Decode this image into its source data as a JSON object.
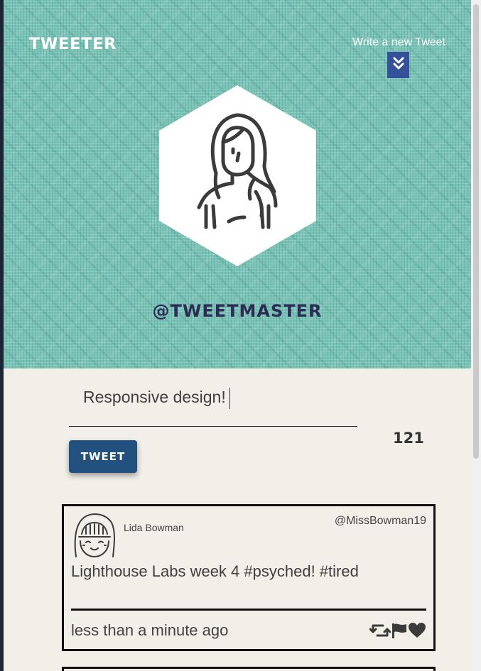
{
  "header": {
    "brand": "TWEETER",
    "write_link": "Write a new Tweet",
    "toggle_icon": "double-chevron-down-icon",
    "handle": "@TWEETMASTER",
    "colors": {
      "background": "#77c3b6",
      "toggle": "#34519a",
      "handle": "#2d2c55"
    }
  },
  "compose": {
    "text": "Responsive design!",
    "counter": "121",
    "button_label": "TWEET",
    "button_color": "#22507f"
  },
  "tweets": [
    {
      "name": "Lida Bowman",
      "username": "@MissBowman19",
      "content": "Lighthouse Labs week 4 #psyched! #tired",
      "time": "less than a minute ago",
      "actions": [
        "retweet-icon",
        "flag-icon",
        "heart-icon"
      ]
    }
  ]
}
